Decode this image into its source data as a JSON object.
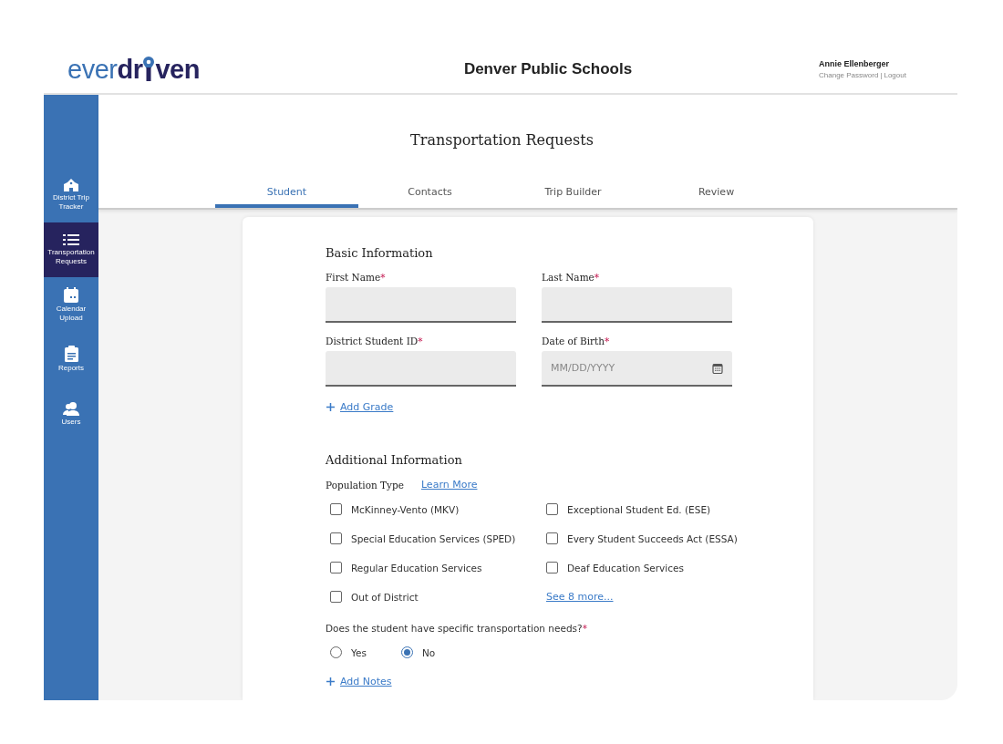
{
  "header": {
    "logo": {
      "light": "ever",
      "bold_start": "dr",
      "bold_end": "ven"
    },
    "title": "Denver Public Schools",
    "user": {
      "name": "Annie Ellenberger",
      "links": [
        "Change Password",
        "Logout"
      ],
      "separator": "|"
    }
  },
  "sidebar": {
    "items": [
      {
        "label": "District Trip Tracker",
        "selected": false
      },
      {
        "label": "Transportation Requests",
        "selected": true
      },
      {
        "label": "Calendar Upload",
        "selected": false
      },
      {
        "label": "Reports",
        "selected": false
      },
      {
        "label": "Users",
        "selected": false
      }
    ]
  },
  "page_title": "Transportation Requests",
  "tabs": [
    {
      "label": "Student",
      "selected": true
    },
    {
      "label": "Contacts",
      "selected": false
    },
    {
      "label": "Trip Builder",
      "selected": false
    },
    {
      "label": "Review",
      "selected": false
    }
  ],
  "form": {
    "basic": {
      "title": "Basic Information",
      "fields": [
        {
          "label": "First Name",
          "required_mark": "*",
          "kind": "text"
        },
        {
          "label": "Last Name",
          "required_mark": "*",
          "kind": "text"
        },
        {
          "label": "District Student ID",
          "required_mark": "*",
          "kind": "text"
        },
        {
          "label": "Date of Birth",
          "required_mark": "*",
          "placeholder": "MM/DD/YYYY",
          "kind": "date"
        }
      ],
      "add_link": "Add Grade"
    },
    "additional": {
      "title": "Additional Information",
      "population_label": "Population Type",
      "learn_more": "Learn More",
      "options": [
        {
          "label": "McKinney-Vento (MKV)",
          "checked": false
        },
        {
          "label": "Exceptional Student Ed. (ESE)",
          "checked": false
        },
        {
          "label": "Special Education Services (SPED)",
          "checked": false
        },
        {
          "label": "Every Student Succeeds Act (ESSA)",
          "checked": false
        },
        {
          "label": "Regular Education Services",
          "checked": false
        },
        {
          "label": "Deaf Education Services",
          "checked": false
        },
        {
          "label": "Out of District",
          "checked": false
        }
      ],
      "see_more": "See 8 more...",
      "question": {
        "label": "Does the student have specific transportation needs?",
        "required_mark": "*",
        "options": [
          {
            "label": "Yes",
            "selected": false
          },
          {
            "label": "No",
            "selected": true
          }
        ]
      },
      "add_link": "Add Notes"
    }
  }
}
